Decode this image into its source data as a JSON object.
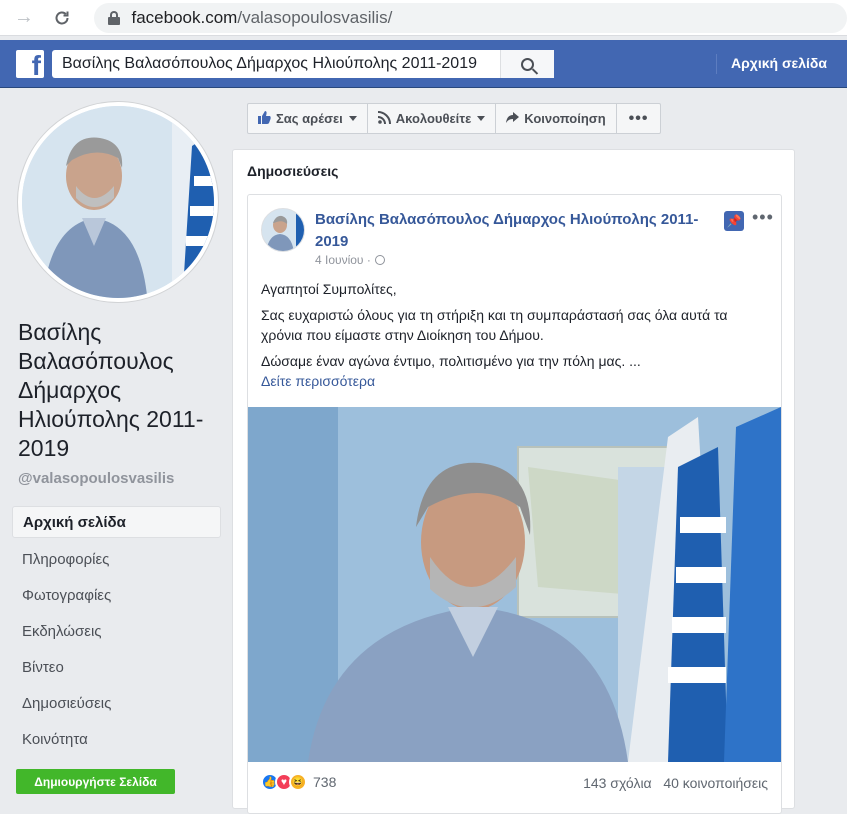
{
  "browser": {
    "url_domain": "facebook.com",
    "url_path": "/valasopoulosvasilis/"
  },
  "header": {
    "search_value": "Βασίλης Βαλασόπουλος Δήμαρχος Ηλιούπολης 2011-2019",
    "home_label": "Αρχική σελίδα"
  },
  "profile": {
    "name": "Βασίλης Βαλασόπουλος Δήμαρχος Ηλιούπολης 2011-2019",
    "handle": "@valasopoulosvasilis"
  },
  "nav": {
    "items": [
      {
        "label": "Αρχική σελίδα"
      },
      {
        "label": "Πληροφορίες"
      },
      {
        "label": "Φωτογραφίες"
      },
      {
        "label": "Εκδηλώσεις"
      },
      {
        "label": "Βίντεο"
      },
      {
        "label": "Δημοσιεύσεις"
      },
      {
        "label": "Κοινότητα"
      }
    ],
    "create_page": "Δημιουργήστε Σελίδα"
  },
  "actions": {
    "like": "Σας αρέσει",
    "follow": "Ακολουθείτε",
    "share": "Κοινοποίηση"
  },
  "posts": {
    "title": "Δημοσιεύσεις",
    "post": {
      "author": "Βασίλης Βαλασόπουλος Δήμαρχος Ηλιούπολης 2011-2019",
      "date": "4 Ιουνίου",
      "paragraph1": "Αγαπητοί Συμπολίτες,",
      "paragraph2": "Σας ευχαριστώ όλους για τη στήριξη και τη συμπαράστασή σας όλα αυτά τα χρόνια που είμαστε στην Διοίκηση του Δήμου.",
      "paragraph3": "Δώσαμε έναν αγώνα έντιμο, πολιτισμένο για την πόλη μας. ...",
      "see_more": "Δείτε περισσότερα",
      "reaction_count": "738",
      "comments": "143 σχόλια",
      "shares": "40 κοινοποιήσεις"
    }
  },
  "colors": {
    "fb_blue": "#4267b2",
    "link": "#365899",
    "green": "#42b72a"
  }
}
